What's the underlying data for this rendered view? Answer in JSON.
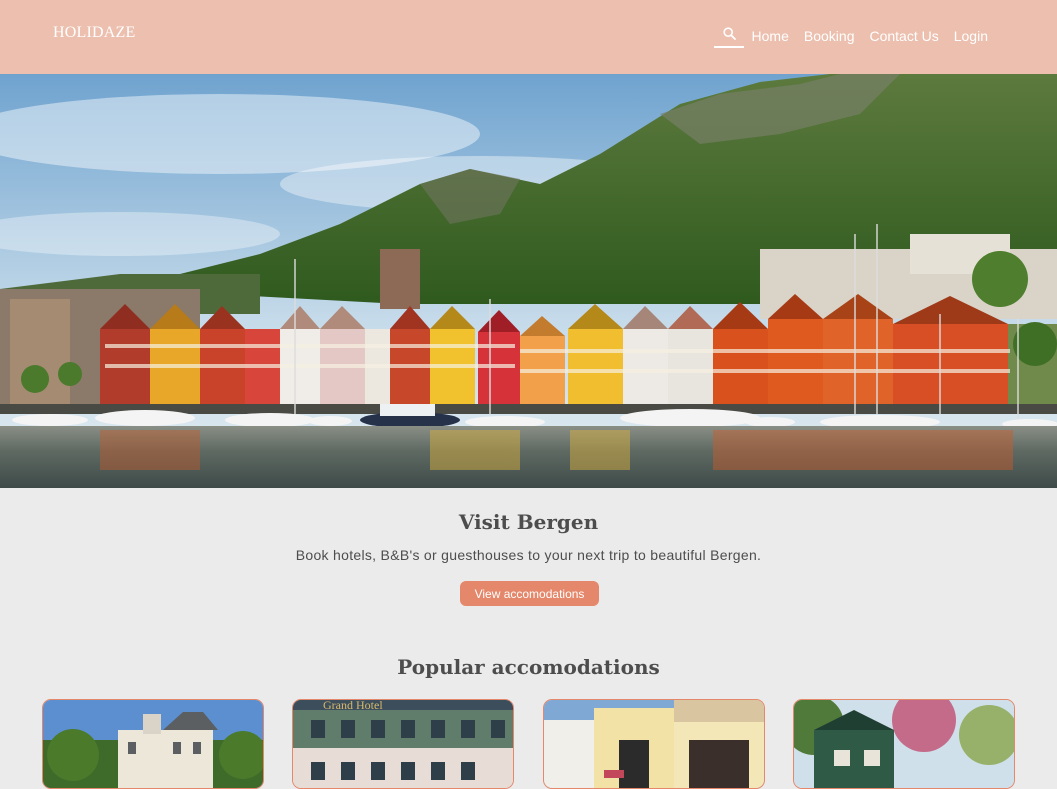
{
  "header": {
    "brand": "HOLIDAZE",
    "nav": {
      "home": "Home",
      "booking": "Booking",
      "contact": "Contact Us",
      "login": "Login"
    }
  },
  "hero": {
    "image": "bergen-harbour-photo"
  },
  "intro": {
    "title": "Visit Bergen",
    "subtitle": "Book hotels, B&B's or guesthouses to your next trip to beautiful Bergen.",
    "cta_label": "View accomodations"
  },
  "popular": {
    "title": "Popular accomodations",
    "cards": [
      {
        "image": "villa-photo"
      },
      {
        "image": "grand-hotel-photo"
      },
      {
        "image": "yellow-guesthouse-photo"
      },
      {
        "image": "green-cottage-photo"
      }
    ]
  },
  "colors": {
    "header_bg": "#ecbfae",
    "accent": "#e4876a",
    "page_bg": "#ebebeb",
    "text": "#4d4d4d"
  }
}
